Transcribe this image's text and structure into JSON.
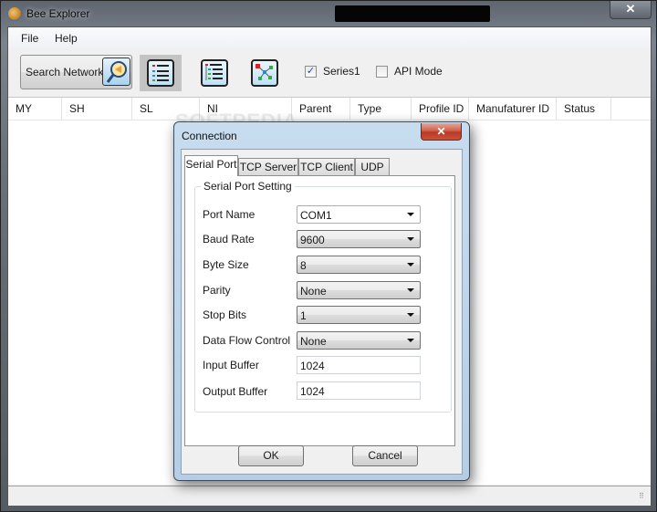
{
  "window": {
    "title": "Bee Explorer",
    "close_label": "✕"
  },
  "menu": {
    "items": [
      {
        "label": "File"
      },
      {
        "label": "Help"
      }
    ]
  },
  "toolbar": {
    "search_label": "Search Network",
    "view_buttons": [
      {
        "icon": "list-view-icon",
        "active": true
      },
      {
        "icon": "tree-view-icon",
        "active": false
      },
      {
        "icon": "network-graph-icon",
        "active": false
      }
    ],
    "checkboxes": [
      {
        "label": "Series1",
        "checked": true,
        "mark": "✓"
      },
      {
        "label": "API Mode",
        "checked": false,
        "mark": ""
      }
    ]
  },
  "table": {
    "columns": [
      "MY",
      "SH",
      "SL",
      "NI",
      "Parent",
      "Type",
      "Profile ID",
      "Manufaturer ID",
      "Status"
    ],
    "rows": []
  },
  "watermark": "SOFTPEDIA",
  "dialog": {
    "title": "Connection",
    "close_label": "✕",
    "tabs": [
      {
        "label": "Serial Port",
        "active": true
      },
      {
        "label": "TCP Server",
        "active": false
      },
      {
        "label": "TCP Client",
        "active": false
      },
      {
        "label": "UDP",
        "active": false
      }
    ],
    "group_title": "Serial Port Setting",
    "fields": [
      {
        "label": "Port Name",
        "value": "COM1",
        "kind": "combo-editable"
      },
      {
        "label": "Baud Rate",
        "value": "9600",
        "kind": "combo"
      },
      {
        "label": "Byte Size",
        "value": "8",
        "kind": "combo"
      },
      {
        "label": "Parity",
        "value": "None",
        "kind": "combo"
      },
      {
        "label": "Stop Bits",
        "value": "1",
        "kind": "combo"
      },
      {
        "label": "Data Flow Control",
        "value": "None",
        "kind": "combo"
      },
      {
        "label": "Input Buffer",
        "value": "1024",
        "kind": "text"
      },
      {
        "label": "Output Buffer",
        "value": "1024",
        "kind": "text"
      }
    ],
    "ok_label": "OK",
    "cancel_label": "Cancel"
  }
}
